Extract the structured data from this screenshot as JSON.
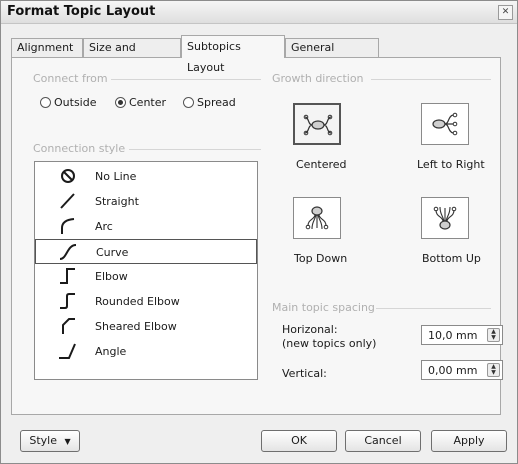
{
  "window": {
    "title": "Format Topic Layout",
    "close_icon": "close-icon"
  },
  "tabs": [
    {
      "label": "Alignment",
      "active": false
    },
    {
      "label": "Size and Margins",
      "active": false
    },
    {
      "label": "Subtopics Layout",
      "active": true
    },
    {
      "label": "General Layout",
      "active": false
    }
  ],
  "connect_from": {
    "title": "Connect from",
    "options": [
      "Outside",
      "Center",
      "Spread"
    ],
    "selected": "Center"
  },
  "connection_style": {
    "title": "Connection style",
    "items": [
      {
        "label": "No Line",
        "icon": "no-line-icon"
      },
      {
        "label": "Straight",
        "icon": "straight-line-icon"
      },
      {
        "label": "Arc",
        "icon": "arc-line-icon"
      },
      {
        "label": "Curve",
        "icon": "curve-line-icon"
      },
      {
        "label": "Elbow",
        "icon": "elbow-line-icon"
      },
      {
        "label": "Rounded Elbow",
        "icon": "rounded-elbow-icon"
      },
      {
        "label": "Sheared Elbow",
        "icon": "sheared-elbow-icon"
      },
      {
        "label": "Angle",
        "icon": "angle-line-icon"
      }
    ],
    "selected": "Curve"
  },
  "growth_direction": {
    "title": "Growth direction",
    "options": [
      {
        "label": "Centered",
        "icon": "centered-layout-icon"
      },
      {
        "label": "Left to Right",
        "icon": "left-to-right-layout-icon"
      },
      {
        "label": "Top Down",
        "icon": "top-down-layout-icon"
      },
      {
        "label": "Bottom Up",
        "icon": "bottom-up-layout-icon"
      }
    ],
    "selected": "Centered"
  },
  "spacing": {
    "title": "Main topic spacing",
    "horizontal_label": "Horizonal:",
    "horizontal_sublabel": "(new topics only)",
    "horizontal_value": "10,0 mm",
    "vertical_label": "Vertical:",
    "vertical_value": "0,00 mm"
  },
  "buttons": {
    "style": "Style",
    "ok": "OK",
    "cancel": "Cancel",
    "apply": "Apply"
  },
  "colors": {
    "dialog_bg": "#efefef",
    "panel_bg": "#f7f7f7",
    "group_title": "#b0b0b0",
    "icon_stroke": "#1b1b1b"
  }
}
